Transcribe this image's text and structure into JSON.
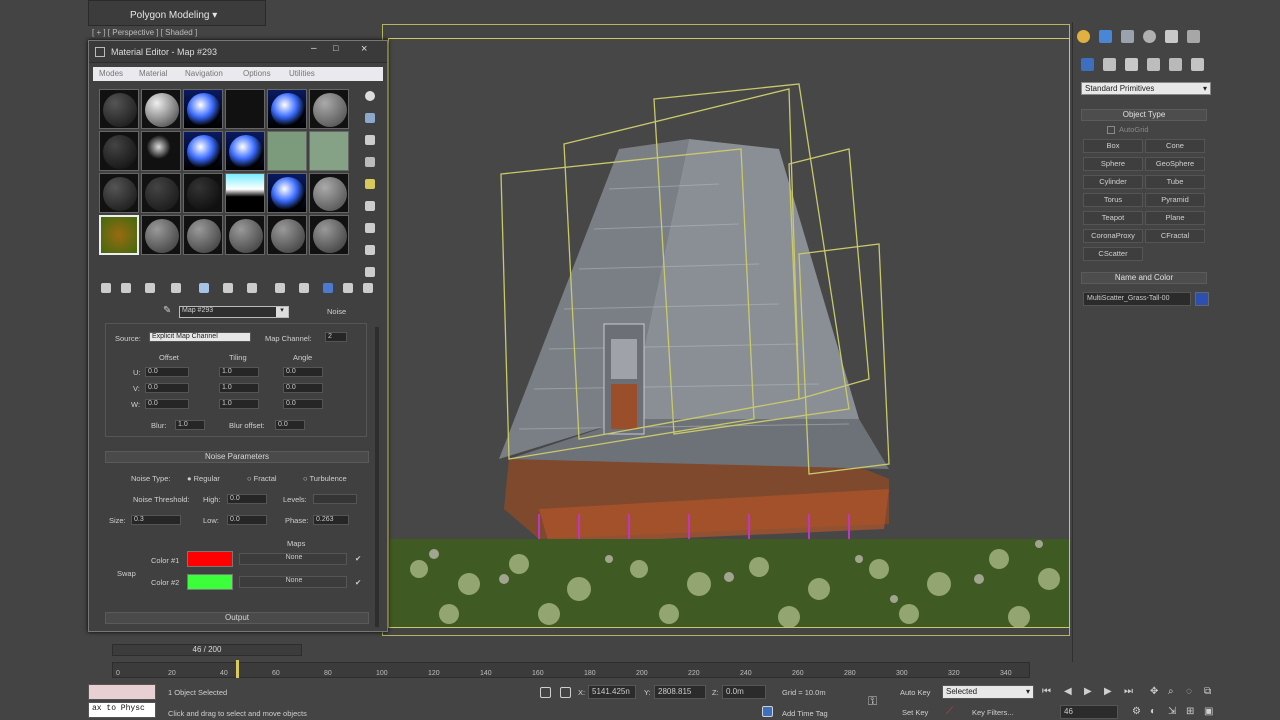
{
  "ribbon": {
    "label": "Polygon Modeling ▾"
  },
  "viewport": {
    "label": "[ + ] [ Perspective ] [ Shaded ]"
  },
  "command_panel": {
    "dropdown": "Standard Primitives",
    "object_type_title": "Object Type",
    "autogrid": "AutoGrid",
    "buttons": [
      "Box",
      "Cone",
      "Sphere",
      "GeoSphere",
      "Cylinder",
      "Tube",
      "Torus",
      "Pyramid",
      "Teapot",
      "Plane",
      "CoronaProxy",
      "CFractal",
      "CScatter"
    ],
    "name_color_title": "Name and Color",
    "name_value": "MultiScatter_Grass-Tall-00"
  },
  "material_editor": {
    "title": "Material Editor - Map #293",
    "menu": [
      "Modes",
      "Material",
      "Navigation",
      "Options",
      "Utilities"
    ],
    "map_name": "Map #293",
    "map_type": "Noise",
    "coordinates": {
      "source_label": "Source:",
      "source_value": "Explicit Map Channel",
      "map_channel_label": "Map Channel:",
      "map_channel_value": "2",
      "offset_label": "Offset",
      "tiling_label": "Tiling",
      "angle_label": "Angle",
      "axes": [
        "U:",
        "V:",
        "W:"
      ],
      "offsets": [
        "0.0",
        "0.0",
        "0.0"
      ],
      "tilings": [
        "1.0",
        "1.0",
        "1.0"
      ],
      "angles": [
        "0.0",
        "0.0",
        "0.0"
      ],
      "blur_label": "Blur:",
      "blur_value": "1.0",
      "blur_offset_label": "Blur offset:",
      "blur_offset_value": "0.0"
    },
    "noise": {
      "rollout_title": "Noise Parameters",
      "noise_type_label": "Noise Type:",
      "types": [
        "Regular",
        "Fractal",
        "Turbulence"
      ],
      "selected_type": "Regular",
      "thresholds_label": "Noise Threshold:",
      "high_label": "High:",
      "high_value": "0.0",
      "levels_label": "Levels:",
      "size_label": "Size:",
      "size_value": "0.3",
      "low_label": "Low:",
      "low_value": "0.0",
      "phase_label": "Phase:",
      "phase_value": "0.263",
      "maps_label": "Maps",
      "swap_label": "Swap",
      "color1_label": "Color #1",
      "color2_label": "Color #2",
      "color1": "#ff0000",
      "color2": "#3cff3c",
      "map1": "None",
      "map2": "None"
    },
    "output_title": "Output"
  },
  "timeline": {
    "frame": "46 / 200",
    "ticks": [
      "0",
      "20",
      "40",
      "60",
      "80",
      "100",
      "120",
      "140",
      "160",
      "180",
      "200",
      "220",
      "240",
      "260",
      "280",
      "300",
      "320",
      "340"
    ]
  },
  "status": {
    "maxscript": "ax to Physc",
    "selection": "1 Object Selected",
    "prompt": "Click and drag to select and move objects",
    "x_label": "X:",
    "x_value": "5141.425n",
    "y_label": "Y:",
    "y_value": "2808.815",
    "z_label": "Z:",
    "z_value": "0.0m",
    "grid": "Grid = 10.0m",
    "add_time_tag": "Add Time Tag",
    "auto_key": "Auto Key",
    "selected": "Selected",
    "set_key": "Set Key",
    "key_filters": "Key Filters...",
    "frame_field": "46"
  },
  "colors": {
    "viewport_bg": "#474747",
    "selection_yellow": "#c9c96a",
    "accent_blue": "#3c6fc0"
  }
}
